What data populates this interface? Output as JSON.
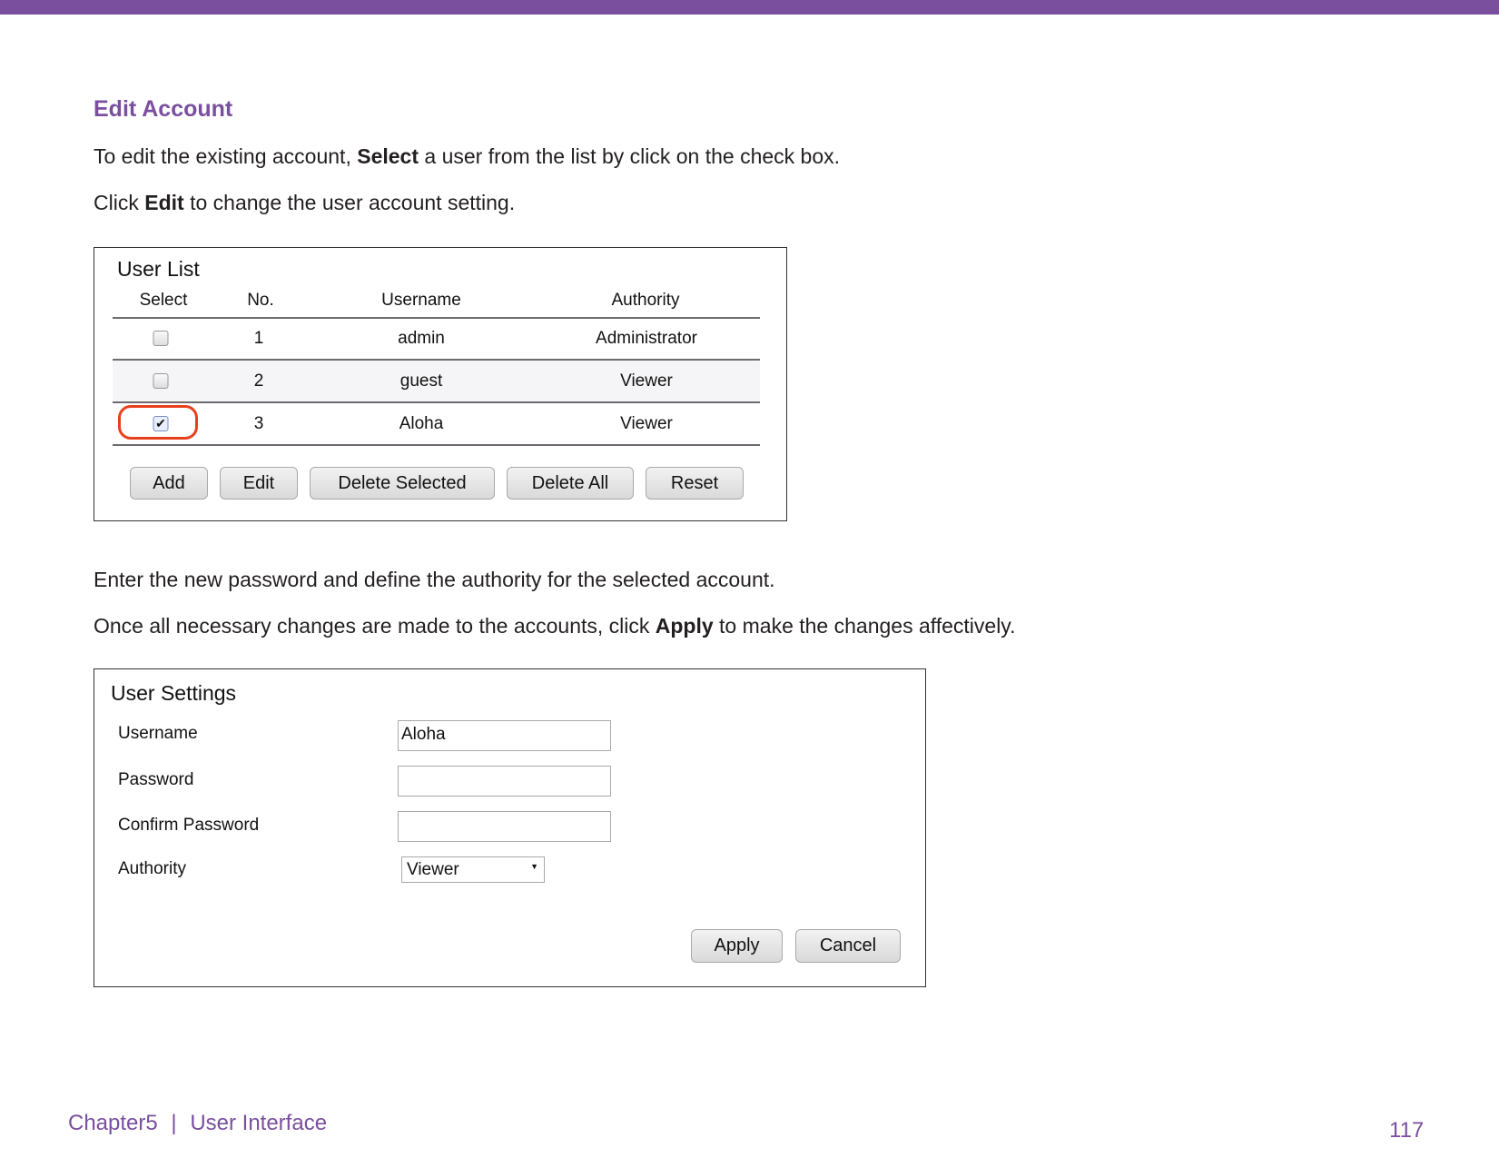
{
  "colors": {
    "accent": "#7a4f9e",
    "highlight": "#e8401c"
  },
  "section_title": "Edit Account",
  "intro": {
    "line1": {
      "pre": "To edit the existing account, ",
      "bold": "Select",
      "post": " a user from the list by click on the check box."
    },
    "line2": {
      "pre": "Click ",
      "bold": "Edit",
      "post": " to change the user account setting."
    }
  },
  "user_list": {
    "title": "User List",
    "columns": [
      "Select",
      "No.",
      "Username",
      "Authority"
    ],
    "rows": [
      {
        "selected": false,
        "no": "1",
        "username": "admin",
        "authority": "Administrator"
      },
      {
        "selected": false,
        "no": "2",
        "username": "guest",
        "authority": "Viewer"
      },
      {
        "selected": true,
        "no": "3",
        "username": "Aloha",
        "authority": "Viewer"
      }
    ],
    "buttons": {
      "add": "Add",
      "edit": "Edit",
      "delete_selected": "Delete Selected",
      "delete_all": "Delete All",
      "reset": "Reset"
    }
  },
  "middle": {
    "line1": "Enter the new password and define the authority for the selected account.",
    "line2": {
      "pre": "Once all necessary changes are made to the accounts, click ",
      "bold": "Apply",
      "post": " to make the changes affectively."
    }
  },
  "user_settings": {
    "title": "User Settings",
    "username_label": "Username",
    "username_value": "Aloha",
    "password_label": "Password",
    "password_value": "",
    "confirm_label": "Confirm Password",
    "confirm_value": "",
    "authority_label": "Authority",
    "authority_value": "Viewer",
    "apply": "Apply",
    "cancel": "Cancel"
  },
  "footer": {
    "chapter": "Chapter5",
    "separator": "|",
    "section": "User Interface",
    "page_number": "117"
  }
}
